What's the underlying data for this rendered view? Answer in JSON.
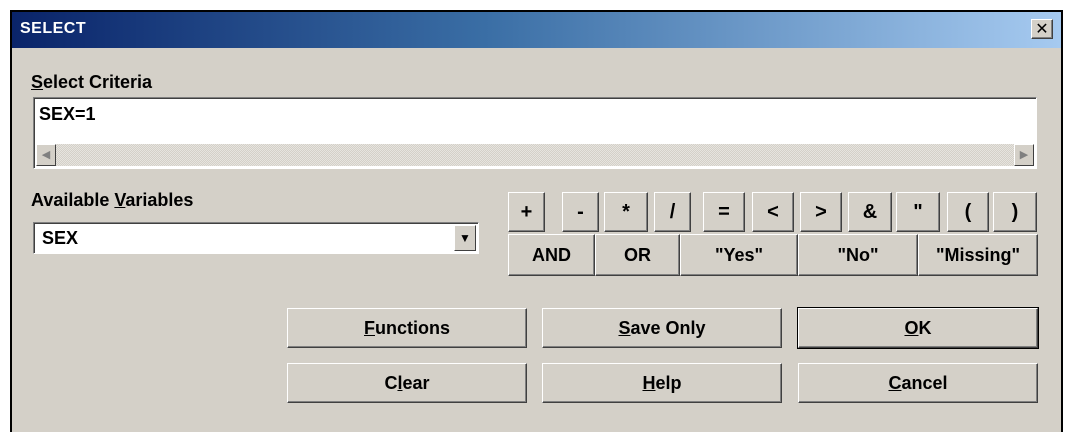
{
  "window": {
    "title": "SELECT",
    "close": "✕"
  },
  "criteria": {
    "label_ul": "S",
    "label_rest": "elect Criteria",
    "value": "SEX=1"
  },
  "variables": {
    "label_pre": "Available ",
    "label_ul": "V",
    "label_rest": "ariables",
    "selected": "SEX"
  },
  "operators": [
    "+",
    "-",
    "*",
    "/",
    "=",
    "<",
    ">",
    "&",
    "\"",
    "(",
    ")"
  ],
  "keywords": [
    "AND",
    "OR",
    "\"Yes\"",
    "\"No\"",
    "\"Missing\""
  ],
  "buttons": {
    "functions": {
      "ul": "F",
      "rest": "unctions"
    },
    "save_only": {
      "ul": "S",
      "rest": "ave Only"
    },
    "ok": {
      "ul": "O",
      "rest": "K"
    },
    "clear": {
      "pre": "C",
      "ul": "l",
      "rest": "ear"
    },
    "help": {
      "ul": "H",
      "rest": "elp"
    },
    "cancel": {
      "ul": "C",
      "rest": "ancel"
    }
  },
  "icons": {
    "scroll_left": "scroll-left-arrow-icon",
    "scroll_right": "scroll-right-arrow-icon",
    "dropdown": "dropdown-arrow-icon"
  }
}
